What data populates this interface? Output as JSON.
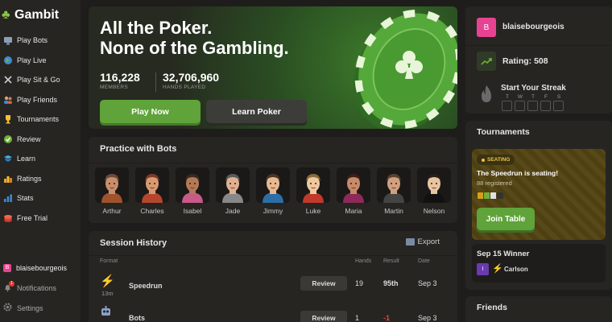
{
  "app": {
    "name": "Gambit"
  },
  "sidebar": {
    "items": [
      {
        "label": "Play Bots",
        "icon": "monitor-icon"
      },
      {
        "label": "Play Live",
        "icon": "globe-icon"
      },
      {
        "label": "Play Sit & Go",
        "icon": "swords-icon"
      },
      {
        "label": "Play Friends",
        "icon": "friends-icon"
      },
      {
        "label": "Tournaments",
        "icon": "trophy-icon"
      },
      {
        "label": "Review",
        "icon": "review-icon"
      },
      {
        "label": "Learn",
        "icon": "learn-icon"
      },
      {
        "label": "Ratings",
        "icon": "ratings-icon"
      },
      {
        "label": "Stats",
        "icon": "stats-icon"
      },
      {
        "label": "Free Trial",
        "icon": "chips-icon"
      }
    ],
    "user": {
      "initial": "B",
      "name": "blaisebourgeois"
    },
    "notifications": {
      "label": "Notifications",
      "count": "1"
    },
    "settings": {
      "label": "Settings"
    }
  },
  "hero": {
    "line1": "All the Poker.",
    "line2": "None of the Gambling.",
    "members": "116,228",
    "members_label": "MEMBERS",
    "hands": "32,706,960",
    "hands_label": "HANDS PLAYED",
    "play_label": "Play Now",
    "learn_label": "Learn Poker"
  },
  "practice": {
    "title": "Practice with Bots",
    "bots": [
      "Arthur",
      "Charles",
      "Isabel",
      "Jade",
      "Jimmy",
      "Luke",
      "Maria",
      "Martin",
      "Nelson"
    ]
  },
  "history": {
    "title": "Session History",
    "export_label": "Export",
    "headers": {
      "format": "Format",
      "hands": "Hands",
      "result": "Result",
      "date": "Date"
    },
    "rows": [
      {
        "icon": "lightning-icon",
        "sub": "13m",
        "name": "Speedrun",
        "review": "Review",
        "hands": "19",
        "result": "95th",
        "date": "Sep 3"
      },
      {
        "icon": "robot-icon",
        "sub": "",
        "name": "Bots",
        "review": "Review",
        "hands": "1",
        "result": "-1",
        "date": "Sep 3"
      }
    ]
  },
  "profile": {
    "initial": "B",
    "name": "blaisebourgeois",
    "rating": "Rating: 508",
    "streak_label": "Start Your Streak",
    "days": [
      "T",
      "W",
      "T",
      "F",
      "S"
    ]
  },
  "tournaments": {
    "title": "Tournaments",
    "badge": "SEATING",
    "message": "The Speedrun is seating!",
    "registered": "88 registered",
    "join_label": "Join Table",
    "winner_title": "Sep 15 Winner",
    "winner_initial": "I",
    "winner_name": "Carlson"
  },
  "friends": {
    "title": "Friends"
  },
  "colors": {
    "accent": "#5fa33a",
    "background": "#1e1d1b",
    "panel": "#262522",
    "negative": "#e04848",
    "gold": "#f2c230"
  }
}
